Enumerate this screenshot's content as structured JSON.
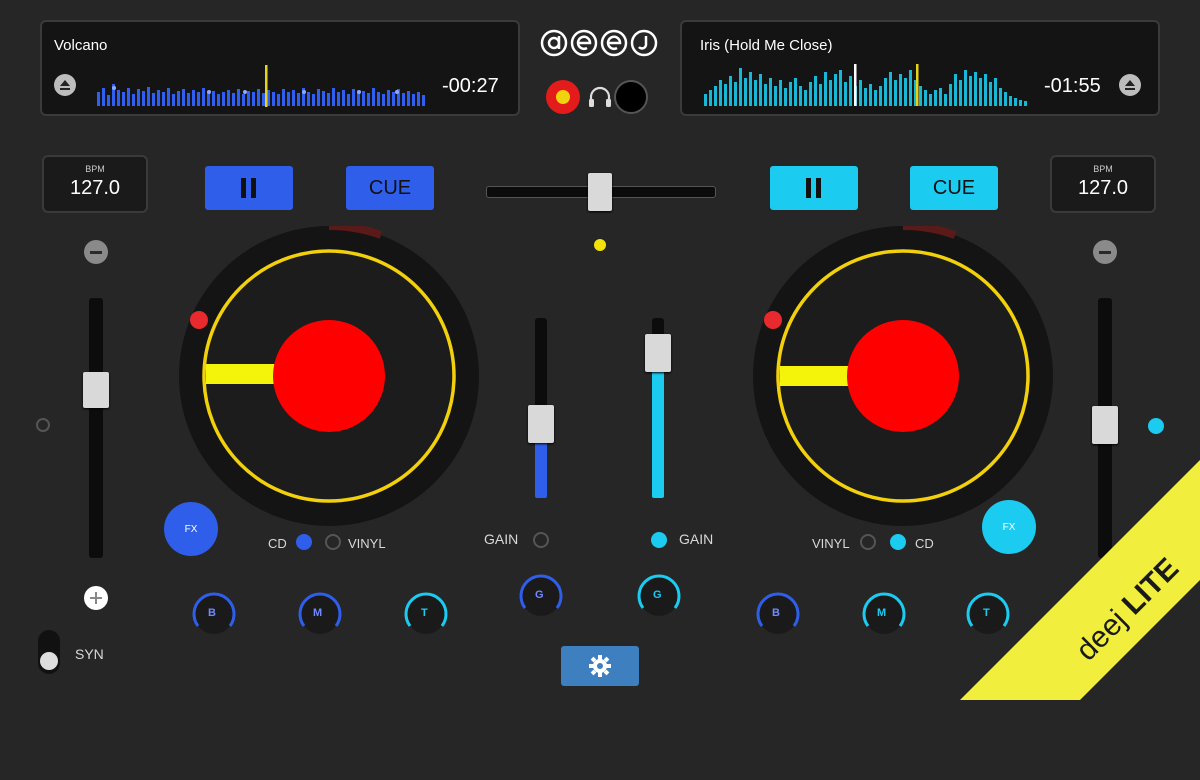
{
  "deck_left": {
    "track_title": "Volcano",
    "time_remaining": "-00:27",
    "bpm_label": "BPM",
    "bpm_value": "127.0",
    "cue_label": "CUE",
    "fx_label": "FX",
    "mode_cd": "CD",
    "mode_vinyl": "VINYL",
    "eq": [
      "B",
      "M",
      "T"
    ],
    "accent": "#2e5eea",
    "gain_label": "GAIN",
    "gain_knob": "G",
    "sync_label": "SYN"
  },
  "deck_right": {
    "track_title": "Iris (Hold Me Close)",
    "time_remaining": "-01:55",
    "bpm_label": "BPM",
    "bpm_value": "127.0",
    "cue_label": "CUE",
    "fx_label": "FX",
    "mode_vinyl": "VINYL",
    "mode_cd": "CD",
    "eq": [
      "B",
      "M",
      "T"
    ],
    "accent": "#1bcbf0",
    "gain_label": "GAIN",
    "gain_knob": "G"
  },
  "brand": {
    "logo_text": "deej",
    "banner_deej": "deej",
    "banner_lite": "LITE"
  },
  "colors": {
    "platter_ring": "#f2d00c",
    "platter_center": "#ff0000",
    "needle": "#f4f40a",
    "banner": "#f1ee3e"
  },
  "icons": {
    "settings": "gear-icon",
    "headphones": "headphones-icon",
    "eject": "eject-icon",
    "record": "record-icon"
  }
}
